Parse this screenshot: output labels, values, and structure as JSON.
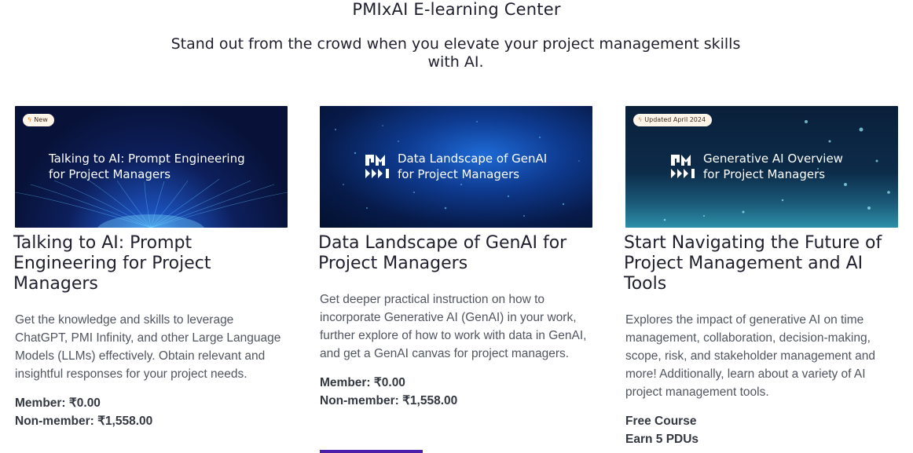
{
  "header": {
    "title": "PMIxAI E-learning Center",
    "subtitle": "Stand out from the crowd when you elevate your project management skills with AI."
  },
  "cards": [
    {
      "badge": "New",
      "banner_text_line1": "Talking to AI: Prompt Engineering",
      "banner_text_line2": "for Project Managers",
      "title": "Talking to AI: Prompt Engineering for Project Managers",
      "description": "Get the knowledge and skills to leverage ChatGPT, PMI Infinity, and other Large Language Models (LLMs) effectively. Obtain relevant and insightful responses for your project needs.",
      "price_line1": "Member: ₹0.00",
      "price_line2": "Non-member: ₹1,558.00"
    },
    {
      "badge": "",
      "banner_text_line1": "Data Landscape of GenAI",
      "banner_text_line2": "for Project Managers",
      "title": "Data Landscape of GenAI for Project Managers",
      "description": "Get deeper practical instruction on how to incorporate Generative AI (GenAI) in your work, further explore of how to work with data in GenAI, and get a GenAI canvas for project managers.",
      "price_line1": "Member: ₹0.00",
      "price_line2": "Non-member: ₹1,558.00"
    },
    {
      "badge": "Updated April 2024",
      "banner_text_line1": "Generative AI Overview",
      "banner_text_line2": "for Project Managers",
      "title": "Start Navigating the Future of Project Management and AI Tools",
      "description": "Explores the impact of generative AI on time management, collaboration, decision-making, scope, risk, and stakeholder management and more! Additionally, learn about a variety of AI project management tools.",
      "price_line1": "Free Course",
      "price_line2": "Earn 5 PDUs"
    }
  ],
  "colors": {
    "accent": "#4b1fa8",
    "badge_bolt": "#f07a1a"
  },
  "icons": [
    "bolt-icon",
    "pmi-logo"
  ]
}
